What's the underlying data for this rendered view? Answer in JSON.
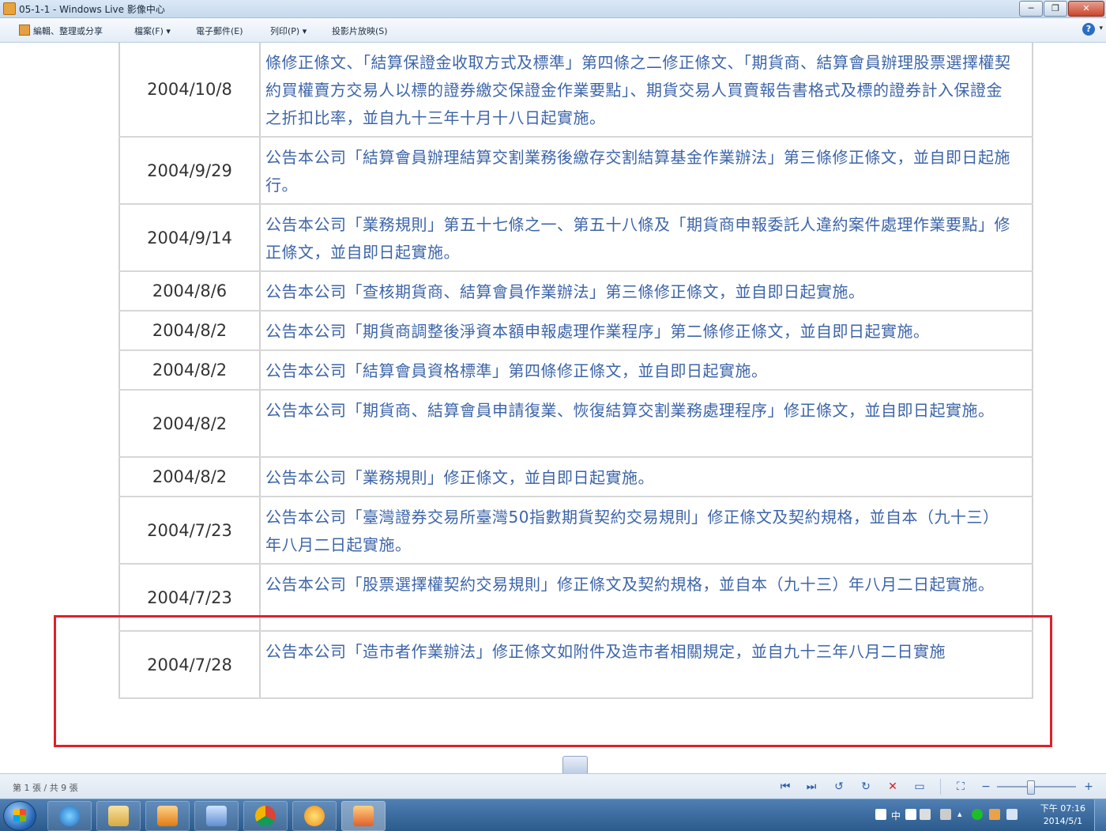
{
  "window": {
    "title": "05-1-1 - Windows Live 影像中心",
    "min_label": "─",
    "max_label": "❐",
    "close_label": "✕"
  },
  "menu": {
    "items": [
      {
        "label": "編輯、整理或分享"
      },
      {
        "label": "檔案(F) ▾"
      },
      {
        "label": "電子郵件(E)"
      },
      {
        "label": "列印(P) ▾"
      },
      {
        "label": "投影片放映(S)"
      }
    ],
    "help": "?"
  },
  "document": {
    "rows": [
      {
        "date": "2004/10/8",
        "text": "條修正條文、「結算保證金收取方式及標準」第四條之二修正條文、「期貨商、結算會員辦理股票選擇權契約買權賣方交易人以標的證券繳交保證金作業要點」、期貨交易人買賣報告書格式及標的證券計入保證金之折扣比率，並自九十三年十月十八日起實施。"
      },
      {
        "date": "2004/9/29",
        "text": "公告本公司「結算會員辦理結算交割業務後繳存交割結算基金作業辦法」第三條修正條文，並自即日起施行。"
      },
      {
        "date": "2004/9/14",
        "text": "公告本公司「業務規則」第五十七條之一、第五十八條及「期貨商申報委託人違約案件處理作業要點」修正條文，並自即日起實施。"
      },
      {
        "date": "2004/8/6",
        "text": "公告本公司「查核期貨商、結算會員作業辦法」第三條修正條文，並自即日起實施。"
      },
      {
        "date": "2004/8/2",
        "text": "公告本公司「期貨商調整後淨資本額申報處理作業程序」第二條修正條文，並自即日起實施。"
      },
      {
        "date": "2004/8/2",
        "text": "公告本公司「結算會員資格標準」第四條修正條文，並自即日起實施。"
      },
      {
        "date": "2004/8/2",
        "text": "公告本公司「期貨商、結算會員申請復業、恢復結算交割業務處理程序」修正條文，並自即日起實施。"
      },
      {
        "date": "2004/8/2",
        "text": "公告本公司「業務規則」修正條文，並自即日起實施。"
      },
      {
        "date": "2004/7/23",
        "text": "公告本公司「臺灣證券交易所臺灣50指數期貨契約交易規則」修正條文及契約規格，並自本（九十三）年八月二日起實施。"
      },
      {
        "date": "2004/7/23",
        "text": "公告本公司「股票選擇權契約交易規則」修正條文及契約規格，並自本（九十三）年八月二日起實施。"
      },
      {
        "date": "2004/7/28",
        "text": "公告本公司「造市者作業辦法」修正條文如附件及造市者相關規定，並自九十三年八月二日實施"
      }
    ]
  },
  "status": {
    "page_indicator": "第 1 張 / 共 9 張"
  },
  "controls": {
    "first": "⏮",
    "last": "⏭",
    "rotate_left": "↺",
    "rotate_right": "↻",
    "delete": "✕",
    "slideshow": "▭",
    "fit": "⛶",
    "zoom_out": "−",
    "zoom_in": "+",
    "zoom_level": 0.42
  },
  "taskbar": {
    "clock_time": "下午 07:16",
    "clock_date": "2014/5/1",
    "ime": "中"
  },
  "colors": {
    "link_text": "#3d65a8",
    "highlight": "#e0202a"
  }
}
